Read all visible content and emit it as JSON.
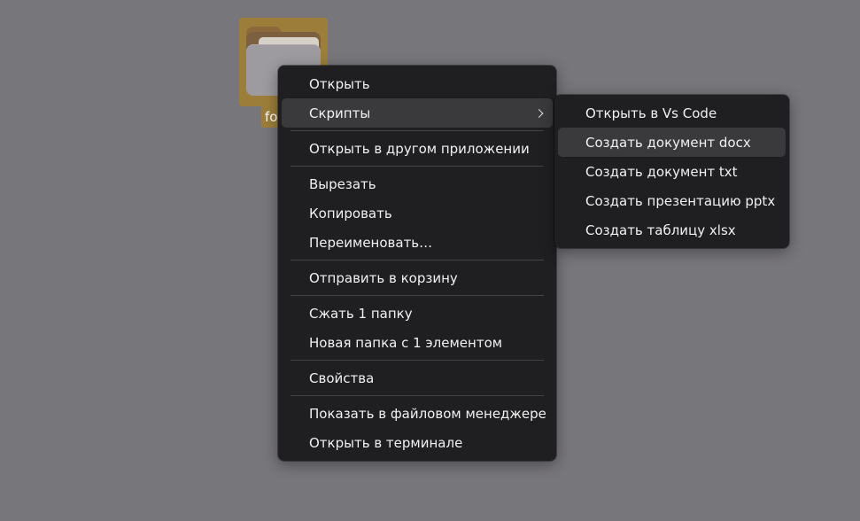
{
  "desktop": {
    "folder_label": "fo"
  },
  "context_menu": {
    "items": [
      {
        "label": "Открыть"
      },
      {
        "label": "Скрипты"
      },
      {
        "label": "Открыть в другом приложении"
      },
      {
        "label": "Вырезать"
      },
      {
        "label": "Копировать"
      },
      {
        "label": "Переименовать…"
      },
      {
        "label": "Отправить в корзину"
      },
      {
        "label": "Сжать 1 папку"
      },
      {
        "label": "Новая папка с 1 элементом"
      },
      {
        "label": "Свойства"
      },
      {
        "label": "Показать в файловом менеджере"
      },
      {
        "label": "Открыть в терминале"
      }
    ]
  },
  "scripts_submenu": {
    "items": [
      {
        "label": "Открыть в Vs Code"
      },
      {
        "label": "Создать документ docx"
      },
      {
        "label": "Создать документ txt"
      },
      {
        "label": "Создать презентацию pptx"
      },
      {
        "label": "Создать таблицу xlsx"
      }
    ]
  },
  "colors": {
    "desktop_background": "#77767b",
    "menu_background": "#1f1f21",
    "hover_background": "#3a3a3c",
    "selection_highlight": "#9c7e3a"
  }
}
